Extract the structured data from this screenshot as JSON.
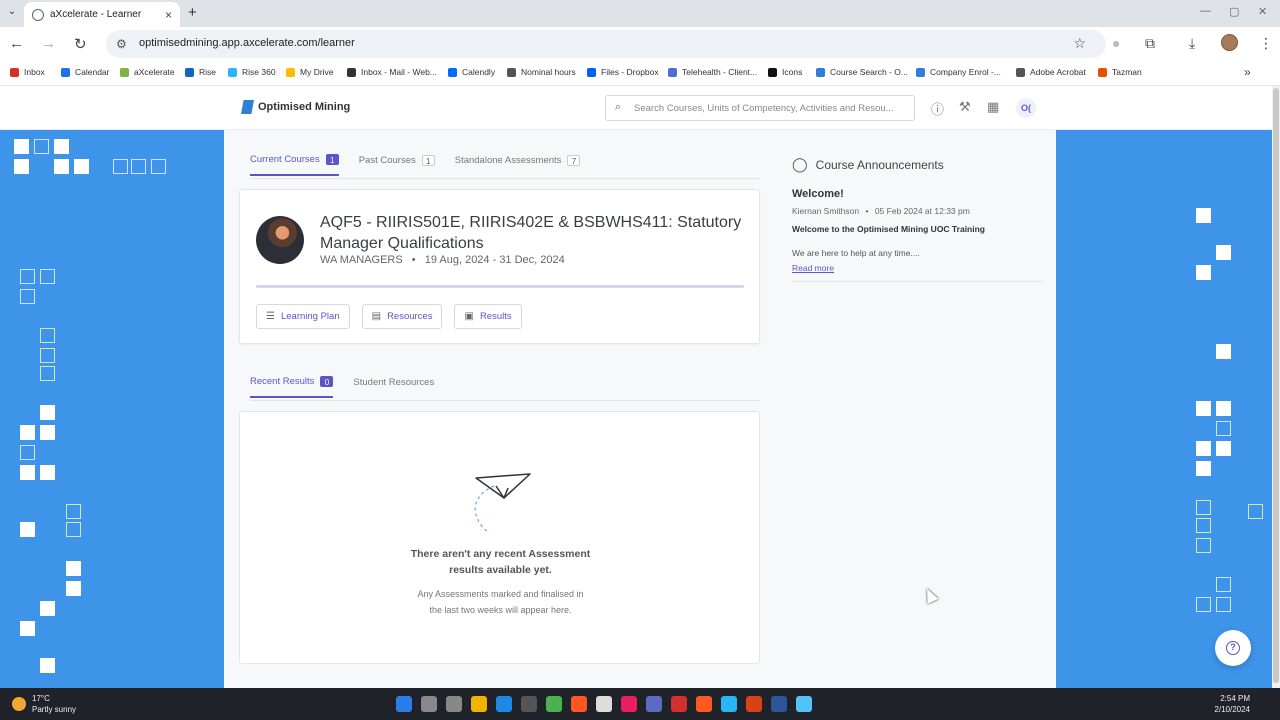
{
  "browser": {
    "tab_title": "aXcelerate - Learner",
    "url": "optimisedmining.app.axcelerate.com/learner",
    "new_tab": "+",
    "bookmarks": [
      {
        "label": "Inbox",
        "color": "#d93025"
      },
      {
        "label": "Calendar",
        "color": "#1a73e8"
      },
      {
        "label": "aXcelerate",
        "color": "#7cb342"
      },
      {
        "label": "Rise",
        "color": "#1565c0"
      },
      {
        "label": "Rise 360",
        "color": "#29b6f6"
      },
      {
        "label": "My Drive",
        "color": "#fbbc04"
      },
      {
        "label": "Inbox - Mail - Web...",
        "color": "#333333"
      },
      {
        "label": "Calendly",
        "color": "#006bff"
      },
      {
        "label": "Nominal hours",
        "color": "#555555"
      },
      {
        "label": "Files - Dropbox",
        "color": "#0061fe"
      },
      {
        "label": "Telehealth - Client...",
        "color": "#4d6cd8"
      },
      {
        "label": "Icons",
        "color": "#111111"
      },
      {
        "label": "Course Search - O...",
        "color": "#2f7fd6"
      },
      {
        "label": "Company Enrol -...",
        "color": "#2f7fd6"
      },
      {
        "label": "Adobe Acrobat",
        "color": "#555555"
      },
      {
        "label": "Tazman",
        "color": "#e65100"
      }
    ]
  },
  "header": {
    "logo_text": "Optimised Mining",
    "search_placeholder": "Search Courses, Units of Competency, Activities and Resou...",
    "user_initials": "O("
  },
  "course_tabs": [
    {
      "label": "Current Courses",
      "count": "1",
      "active": true
    },
    {
      "label": "Past Courses",
      "count": "1",
      "active": false
    },
    {
      "label": "Standalone Assessments",
      "count": "7",
      "active": false
    }
  ],
  "course": {
    "title": "AQF5 - RIIRIS501E, RIIRIS402E & BSBWHS411: Statutory Manager Qualifications",
    "group": "WA MANAGERS",
    "separator": "•",
    "dates": "19 Aug, 2024 - 31 Dec, 2024",
    "progress_fraction": 0,
    "buttons": {
      "learning_plan": "Learning Plan",
      "resources": "Resources",
      "results": "Results"
    }
  },
  "result_tabs": [
    {
      "label": "Recent Results",
      "count": "0",
      "active": true
    },
    {
      "label": "Student Resources",
      "count": null,
      "active": false
    }
  ],
  "empty_state": {
    "title": "There aren't any recent Assessment results available yet.",
    "subtitle": "Any Assessments marked and finalised in the last two weeks will appear here."
  },
  "announcements": {
    "heading": "Course Announcements",
    "title": "Welcome!",
    "author": "Kiernan Smithson",
    "meta_sep": "•",
    "date": "05 Feb 2024 at 12:33 pm",
    "subject": "Welcome to the Optimised Mining UOC Training",
    "body": "We are here to help at any time....",
    "read_more": "Read more"
  },
  "taskbar": {
    "temperature": "17°C",
    "weather": "Partly sunny",
    "time": "2:54 PM",
    "date": "2/10/2024",
    "icon_colors": [
      "#2b7de9",
      "#888888",
      "#888888",
      "#f0b400",
      "#1e88e5",
      "#555555",
      "#4caf50",
      "#ff5722",
      "#dddddd",
      "#e91e63",
      "#5c6bc0",
      "#d32f2f",
      "#ff5722",
      "#29b6f6",
      "#d84315",
      "#2b579a",
      "#4fc3f7"
    ]
  }
}
